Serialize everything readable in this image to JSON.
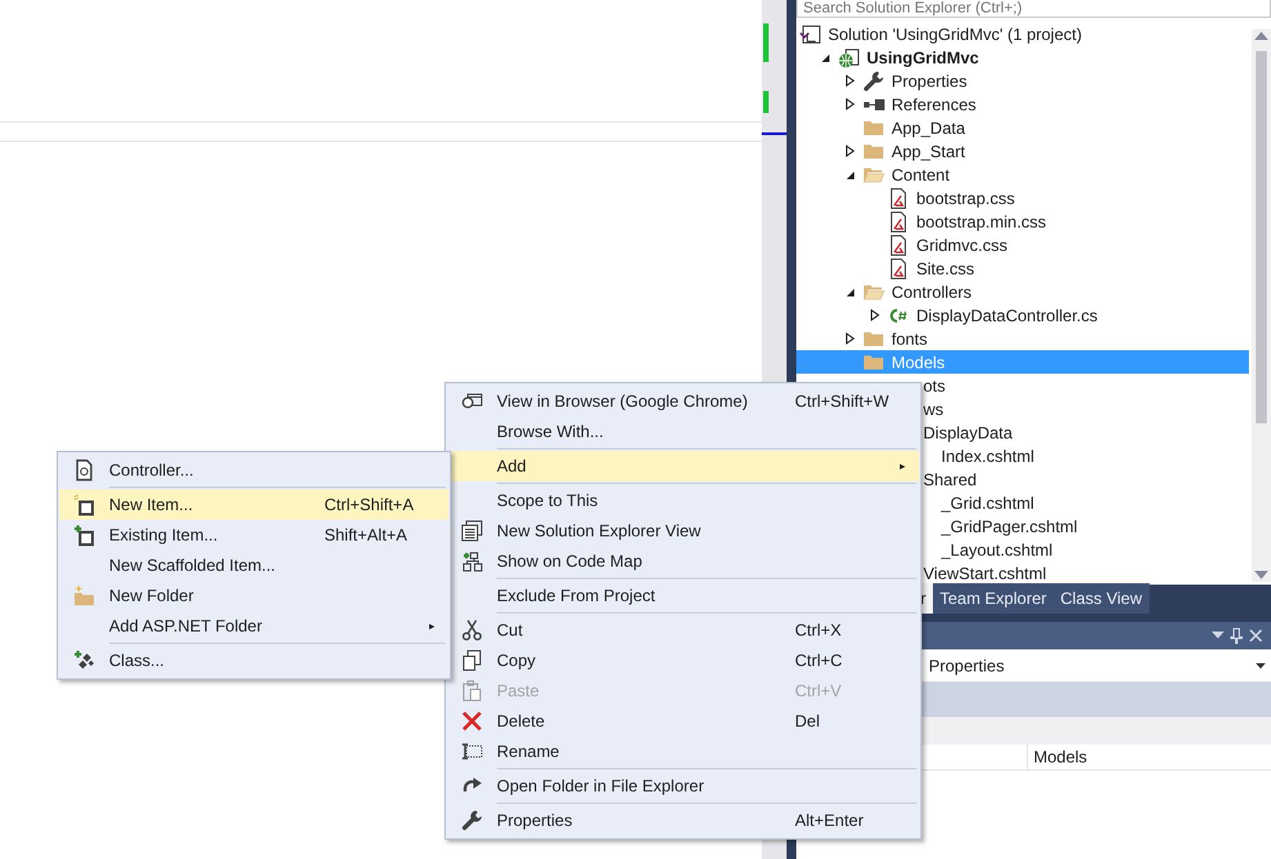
{
  "solution_explorer": {
    "search": {
      "placeholder": "Search Solution Explorer (Ctrl+;)"
    },
    "tree": [
      {
        "kind": "solution",
        "label": "Solution 'UsingGridMvc' (1 project)",
        "selected": false,
        "children": [
          {
            "kind": "project",
            "label": "UsingGridMvc",
            "selected": false,
            "expanded": true,
            "children": [
              {
                "kind": "properties",
                "label": "Properties",
                "selected": false,
                "expanded": false
              },
              {
                "kind": "references",
                "label": "References",
                "selected": false,
                "expanded": false
              },
              {
                "kind": "folder",
                "label": "App_Data",
                "selected": false
              },
              {
                "kind": "folder",
                "label": "App_Start",
                "selected": false,
                "expanded": false
              },
              {
                "kind": "folder",
                "label": "Content",
                "selected": false,
                "expanded": true,
                "children": [
                  {
                    "kind": "css",
                    "label": "bootstrap.css",
                    "selected": false
                  },
                  {
                    "kind": "css",
                    "label": "bootstrap.min.css",
                    "selected": false
                  },
                  {
                    "kind": "css",
                    "label": "Gridmvc.css",
                    "selected": false
                  },
                  {
                    "kind": "css",
                    "label": "Site.css",
                    "selected": false
                  }
                ]
              },
              {
                "kind": "folder",
                "label": "Controllers",
                "selected": false,
                "expanded": true,
                "children": [
                  {
                    "kind": "csharp",
                    "label": "DisplayDataController.cs",
                    "selected": false,
                    "expanded": false
                  }
                ]
              },
              {
                "kind": "folder",
                "label": "fonts",
                "selected": false,
                "expanded": false
              },
              {
                "kind": "folder",
                "label": "Models",
                "selected": true
              },
              {
                "kind": "partial",
                "label": "ots",
                "selected": false
              },
              {
                "kind": "partial",
                "label": "ws",
                "selected": false,
                "children": [
                  {
                    "kind": "partial",
                    "label": "DisplayData",
                    "selected": false,
                    "children": [
                      {
                        "kind": "partial",
                        "label": "Index.cshtml",
                        "selected": false
                      }
                    ]
                  },
                  {
                    "kind": "partial",
                    "label": "Shared",
                    "selected": false,
                    "children": [
                      {
                        "kind": "partial",
                        "label": "_Grid.cshtml",
                        "selected": false
                      },
                      {
                        "kind": "partial",
                        "label": "_GridPager.cshtml",
                        "selected": false
                      },
                      {
                        "kind": "partial",
                        "label": "_Layout.cshtml",
                        "selected": false
                      }
                    ]
                  },
                  {
                    "kind": "partial",
                    "label": "ViewStart.cshtml",
                    "selected": false
                  }
                ]
              }
            ]
          }
        ]
      }
    ]
  },
  "tool_tabs": [
    {
      "label": "r",
      "selected": true
    },
    {
      "label": "Team Explorer",
      "selected": false
    },
    {
      "label": "Class View",
      "selected": false
    }
  ],
  "properties_panel": {
    "object_combo": "Properties",
    "value": "Models"
  },
  "context_menu": {
    "items": [
      {
        "kind": "browser",
        "label": "View in Browser (Google Chrome)",
        "shortcut": "Ctrl+Shift+W",
        "submenu": false,
        "selected": false,
        "disabled": false
      },
      {
        "kind": "plain",
        "label": "Browse With...",
        "submenu": false,
        "selected": false,
        "disabled": false
      },
      {
        "kind": "separator"
      },
      {
        "kind": "plain",
        "label": "Add",
        "submenu": true,
        "selected": true,
        "disabled": false
      },
      {
        "kind": "separator"
      },
      {
        "kind": "plain",
        "label": "Scope to This",
        "submenu": false,
        "selected": false,
        "disabled": false
      },
      {
        "kind": "new-view",
        "label": "New Solution Explorer View",
        "submenu": false,
        "selected": false,
        "disabled": false
      },
      {
        "kind": "code-map",
        "label": "Show on Code Map",
        "submenu": false,
        "selected": false,
        "disabled": false
      },
      {
        "kind": "separator"
      },
      {
        "kind": "plain",
        "label": "Exclude From Project",
        "submenu": false,
        "selected": false,
        "disabled": false
      },
      {
        "kind": "separator"
      },
      {
        "kind": "cut",
        "label": "Cut",
        "shortcut": "Ctrl+X",
        "submenu": false,
        "selected": false,
        "disabled": false
      },
      {
        "kind": "copy",
        "label": "Copy",
        "shortcut": "Ctrl+C",
        "submenu": false,
        "selected": false,
        "disabled": false
      },
      {
        "kind": "paste",
        "label": "Paste",
        "shortcut": "Ctrl+V",
        "submenu": false,
        "selected": false,
        "disabled": true
      },
      {
        "kind": "delete",
        "label": "Delete",
        "shortcut": "Del",
        "submenu": false,
        "selected": false,
        "disabled": false
      },
      {
        "kind": "rename",
        "label": "Rename",
        "submenu": false,
        "selected": false,
        "disabled": false
      },
      {
        "kind": "separator"
      },
      {
        "kind": "open-folder",
        "label": "Open Folder in File Explorer",
        "submenu": false,
        "selected": false,
        "disabled": false
      },
      {
        "kind": "separator"
      },
      {
        "kind": "wrench",
        "label": "Properties",
        "shortcut": "Alt+Enter",
        "submenu": false,
        "selected": false,
        "disabled": false
      }
    ]
  },
  "add_submenu": {
    "items": [
      {
        "kind": "controller",
        "label": "Controller...",
        "submenu": false,
        "selected": false,
        "disabled": false
      },
      {
        "kind": "separator"
      },
      {
        "kind": "new-item",
        "label": "New Item...",
        "shortcut": "Ctrl+Shift+A",
        "submenu": false,
        "selected": true,
        "disabled": false
      },
      {
        "kind": "existing-item",
        "label": "Existing Item...",
        "shortcut": "Shift+Alt+A",
        "submenu": false,
        "selected": false,
        "disabled": false
      },
      {
        "kind": "plain",
        "label": "New Scaffolded Item...",
        "submenu": false,
        "selected": false,
        "disabled": false
      },
      {
        "kind": "new-folder",
        "label": "New Folder",
        "submenu": false,
        "selected": false,
        "disabled": false
      },
      {
        "kind": "plain",
        "label": "Add ASP.NET Folder",
        "submenu": true,
        "selected": false,
        "disabled": false
      },
      {
        "kind": "separator"
      },
      {
        "kind": "class",
        "label": "Class...",
        "submenu": false,
        "selected": false,
        "disabled": false
      }
    ]
  }
}
